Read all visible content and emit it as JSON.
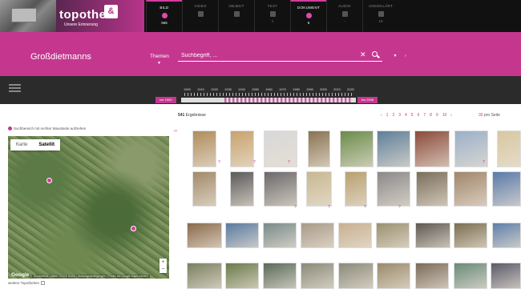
{
  "header": {
    "logo_text": "topothek",
    "logo_tagline": "Unsere Erinnerung",
    "logo_mark": "&",
    "tabs": [
      {
        "label": "BILD",
        "count": "555",
        "active": true
      },
      {
        "label": "VIDEO",
        "count": "-",
        "active": false
      },
      {
        "label": "OBJEKT",
        "count": "-",
        "active": false
      },
      {
        "label": "TEXT",
        "count": "1",
        "active": false
      },
      {
        "label": "DOKUMENT",
        "count": "6",
        "active": true
      },
      {
        "label": "AUDIO",
        "count": "-",
        "active": false
      },
      {
        "label": "UNGEKLÄRT",
        "count": "19",
        "active": false
      }
    ]
  },
  "search": {
    "place": "Großdietmanns",
    "themen_label": "Themen",
    "placeholder": "Suchbegriff, ..."
  },
  "timeline": {
    "years": [
      "1900",
      "1910",
      "1920",
      "1930",
      "1940",
      "1950",
      "1960",
      "1970",
      "1980",
      "1990",
      "2000",
      "2010",
      "2020"
    ],
    "from_label": "vor 1900",
    "to_label": "bis 2006"
  },
  "results": {
    "count": "541",
    "label": "Ergebnisse",
    "pages": [
      "1",
      "2",
      "3",
      "4",
      "5",
      "6",
      "7",
      "8",
      "9",
      "10"
    ],
    "page_size": "30",
    "page_size_suffix": "pro Seite"
  },
  "map": {
    "rect_search_label": "Suchbereich mit rechter Maustaste aufziehen",
    "type_map": "Karte",
    "type_satellite": "Satellit",
    "google_label": "Google",
    "attribution": "Kurzbefehle | Bilder ©2025 NASA | Nutzungsbedingungen | Fehler bei Google Maps melden",
    "other_topotheks_label": "weitere Topotheken"
  },
  "thumbnails": {
    "colors": [
      "#b08c5a",
      "#c9a26b",
      "#d8d8d8",
      "#8a7352",
      "#6a8b4a",
      "#5e7f9a",
      "#8a4a3a",
      "#9ab0c8",
      "#d8c8a0",
      "#a38a6a",
      "#5a5a5a",
      "#6a6a6a",
      "#c8b890",
      "#b8a070",
      "#8a8a8a",
      "#7a6e5a",
      "#a0866a",
      "#5a7aaa",
      "#8a6a4a",
      "#5a7aa0",
      "#7a8a8a",
      "#a89a88",
      "#c8b090",
      "#9a9070",
      "#5e5a52",
      "#7a6e50",
      "#5f7fa8",
      "#7a8060",
      "#6a7a4a",
      "#5a6a5a",
      "#8a8a7a",
      "#8a8a7a",
      "#9a8a6a",
      "#7a6a5a",
      "#6a8a7a",
      "#5a5a6a",
      "#8a8a8a"
    ]
  }
}
